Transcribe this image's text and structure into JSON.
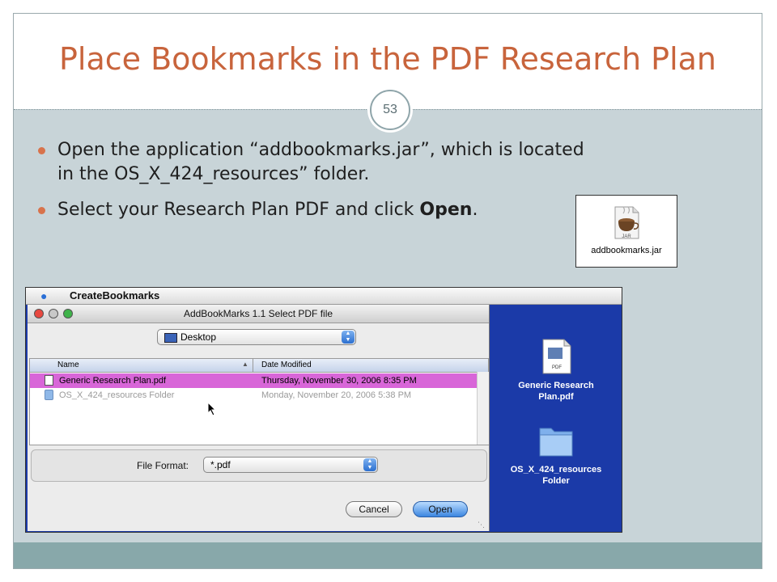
{
  "slide": {
    "title": "Place Bookmarks in the PDF Research Plan",
    "page_number": "53",
    "bullets": [
      "Open the application “addbookmarks.jar”, which is located in the OS_X_424_resources” folder.",
      "Select your Research Plan PDF and click "
    ],
    "bullet2_emphasis": "Open",
    "bullet2_end": ".",
    "accent_color": "#c8643c"
  },
  "jar_icon": {
    "label": "addbookmarks.jar",
    "badge": "JAR",
    "icon": "java-jar-icon"
  },
  "screenshot": {
    "menubar": {
      "app_name": "CreateBookmarks",
      "icon": "apple-icon"
    },
    "dialog": {
      "title": "AddBookMarks 1.1  Select PDF file",
      "location_popup": "Desktop",
      "columns": {
        "name": "Name",
        "date": "Date Modified"
      },
      "files": [
        {
          "name": "Generic Research Plan.pdf",
          "date": "Thursday, November 30, 2006 8:35 PM",
          "selected": true,
          "icon": "pdf-file-icon"
        },
        {
          "name": "OS_X_424_resources Folder",
          "date": "Monday, November 20, 2006 5:38 PM",
          "selected": false,
          "icon": "folder-icon"
        }
      ],
      "file_format_label": "File Format:",
      "file_format_value": "*.pdf",
      "cancel_label": "Cancel",
      "open_label": "Open"
    },
    "desktop": [
      {
        "label": "Generic Research Plan.pdf",
        "line1": "Generic Research",
        "line2": "Plan.pdf",
        "icon": "pdf-file-icon",
        "badge": "PDF"
      },
      {
        "label": "OS_X_424_resources Folder",
        "line1": "OS_X_424_resources",
        "line2": "Folder",
        "icon": "folder-icon"
      }
    ]
  }
}
